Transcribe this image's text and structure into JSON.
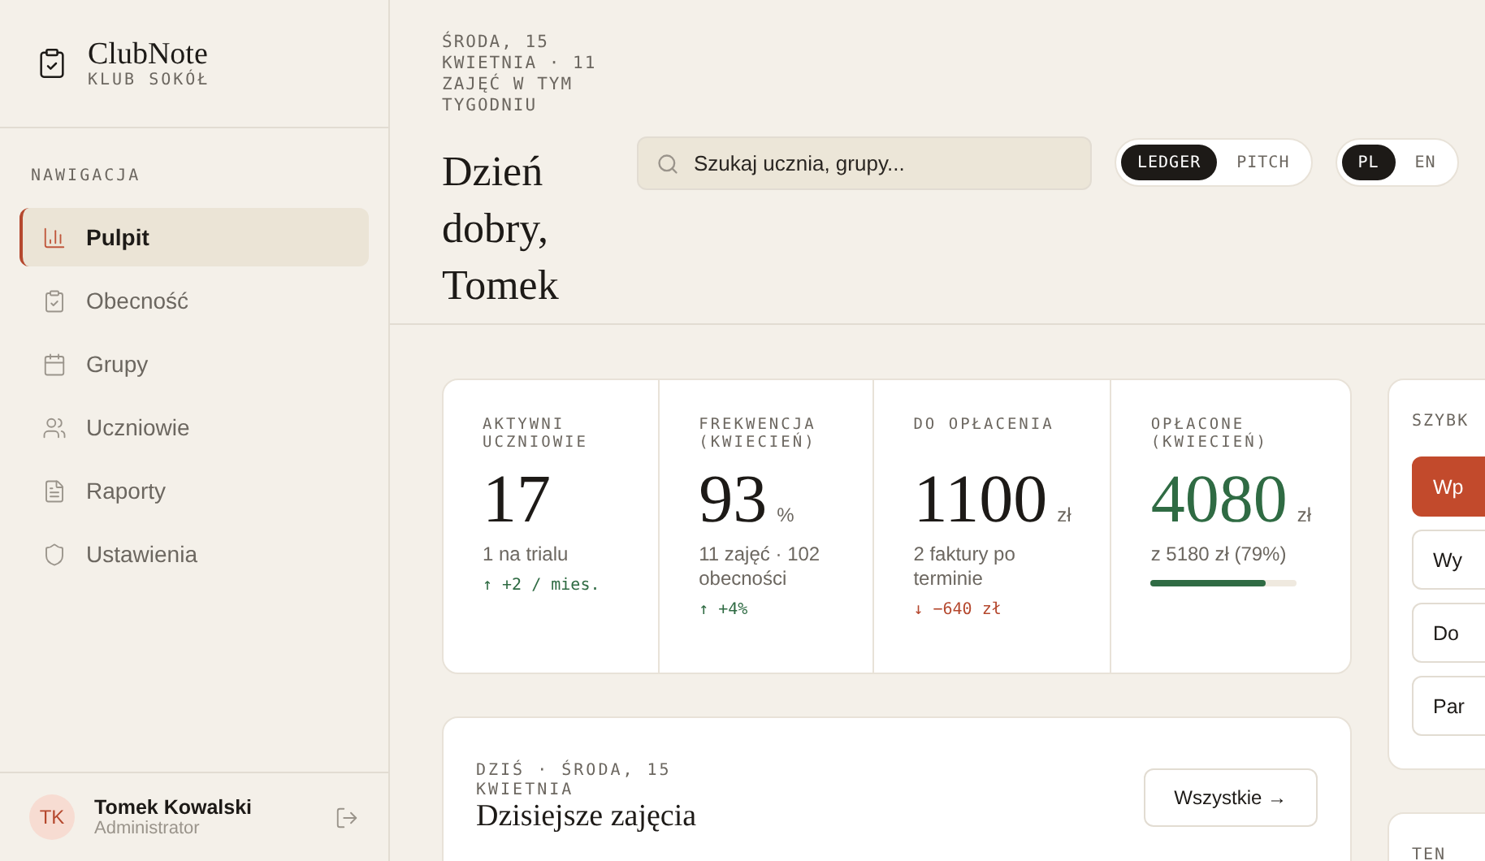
{
  "brand": {
    "name": "ClubNote",
    "club": "KLUB SOKÓŁ"
  },
  "sidebar": {
    "section_label": "NAWIGACJA",
    "items": [
      {
        "label": "Pulpit",
        "selected": true
      },
      {
        "label": "Obecność",
        "selected": false
      },
      {
        "label": "Grupy",
        "selected": false
      },
      {
        "label": "Uczniowie",
        "selected": false
      },
      {
        "label": "Raporty",
        "selected": false
      },
      {
        "label": "Ustawienia",
        "selected": false
      }
    ]
  },
  "user": {
    "initials": "TK",
    "name": "Tomek Kowalski",
    "role": "Administrator"
  },
  "header": {
    "date_line": "ŚRODA, 15 KWIETNIA · 11 ZAJĘĆ W TYM TYGODNIU",
    "greeting": "Dzień dobry, Tomek"
  },
  "search": {
    "placeholder": "Szukaj ucznia, grupy..."
  },
  "view_toggle": [
    {
      "label": "LEDGER",
      "selected": true
    },
    {
      "label": "PITCH",
      "selected": false
    }
  ],
  "language_toggle": [
    {
      "label": "PL",
      "selected": true
    },
    {
      "label": "EN",
      "selected": false
    }
  ],
  "stats": [
    {
      "label": "AKTYWNI UCZNIOWIE",
      "value": "17",
      "highlight": false,
      "note": "1 na trialu",
      "delta": "↑ +2 / mies.",
      "negative": false
    },
    {
      "label": "FREKWENCJA (KWIECIEŃ)",
      "value": "93",
      "unit": "%",
      "highlight": false,
      "note": "11 zajęć · 102 obecności",
      "delta": "↑ +4%",
      "negative": false
    },
    {
      "label": "DO OPŁACENIA",
      "value": "1100",
      "unit": "zł",
      "highlight": false,
      "note": "2 faktury po terminie",
      "delta": "↓ −640 zł",
      "negative": true
    },
    {
      "label": "OPŁACONE (KWIECIEŃ)",
      "value": "4080",
      "unit": "zł",
      "highlight": true,
      "note": "z 5180 zł (79%)",
      "level": 0.79
    }
  ],
  "lessons": {
    "eyebrow": "DZIŚ · ŚRODA, 15 KWIETNIA",
    "title": "Dzisiejsze zajęcia",
    "button": "Wszystkie →"
  },
  "quick_actions": {
    "title": "SZYBK",
    "buttons": [
      {
        "label": "Wp",
        "primary": true
      },
      {
        "label": "Wy",
        "primary": false
      },
      {
        "label": "Do",
        "primary": false
      },
      {
        "label": "Par",
        "primary": false
      }
    ]
  },
  "second_panel": {
    "title": "TEN"
  }
}
